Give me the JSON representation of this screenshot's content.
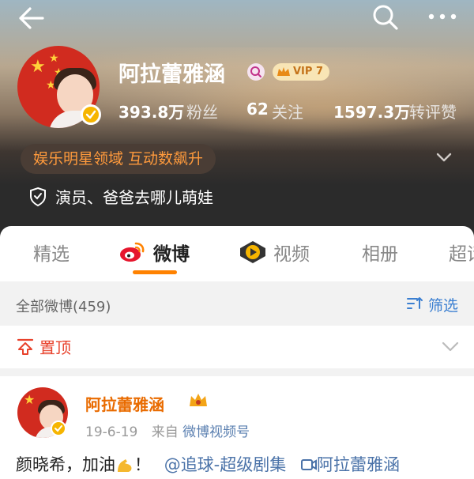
{
  "profile": {
    "name": "阿拉蕾雅涵",
    "vip_badge": "VIP 7",
    "stats": [
      {
        "value": "393.8万",
        "label": "粉丝"
      },
      {
        "value": "62",
        "label": "关注"
      },
      {
        "value": "1597.3万",
        "label": "转评赞"
      }
    ],
    "tag": "娱乐明星领域 互动数飙升",
    "intro": "演员、爸爸去哪儿萌娃"
  },
  "tabs": [
    {
      "label": "精选"
    },
    {
      "label": "微博"
    },
    {
      "label": "视频"
    },
    {
      "label": "相册"
    },
    {
      "label": "超话"
    }
  ],
  "filter_bar": {
    "left_label": "全部微博(459)",
    "right_label": "筛选"
  },
  "pinned": {
    "label": "置顶"
  },
  "post": {
    "author": "阿拉蕾雅涵",
    "date": "19-6-19",
    "source_prefix": "来自",
    "source": "微博视频号",
    "text_before": "颜晓希，加油",
    "text_after": "！",
    "mention": "@追球-超级剧集",
    "link_label": "阿拉蕾雅涵"
  },
  "colors": {
    "accent": "#ff8200",
    "pinned": "#e8422c",
    "link": "#4a72a8",
    "author": "#e96b00"
  }
}
